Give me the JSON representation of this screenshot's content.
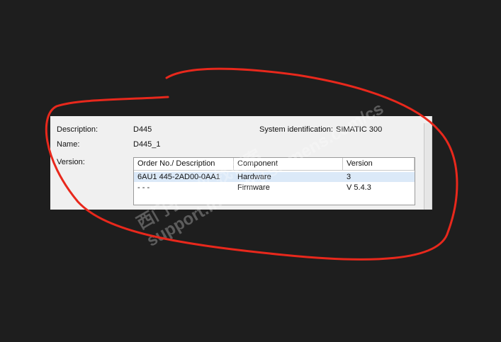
{
  "properties": {
    "description_label": "Description:",
    "description_value": "D445",
    "name_label": "Name:",
    "name_value": "D445_1",
    "system_identification_label": "System identification:",
    "system_identification_value": "SIMATIC 300",
    "version_label": "Version:"
  },
  "version_table": {
    "columns": [
      "Order No./ Description",
      "Component",
      "Version"
    ],
    "rows": [
      {
        "order": "6AU1 445-2AD00-0AA1",
        "component": "Hardware",
        "version": "3",
        "selected": true
      },
      {
        "order": "- - -",
        "component": "Firmware",
        "version": "V 5.4.3",
        "selected": false
      }
    ]
  },
  "colors": {
    "background": "#1e1e1e",
    "panel": "#f0f0f0",
    "selected_row": "#dbe9f8",
    "annotation": "#e8281c"
  },
  "watermark": {
    "text": "support.industry.siemens.com/cs",
    "text2": "西门子工业 找答案"
  }
}
